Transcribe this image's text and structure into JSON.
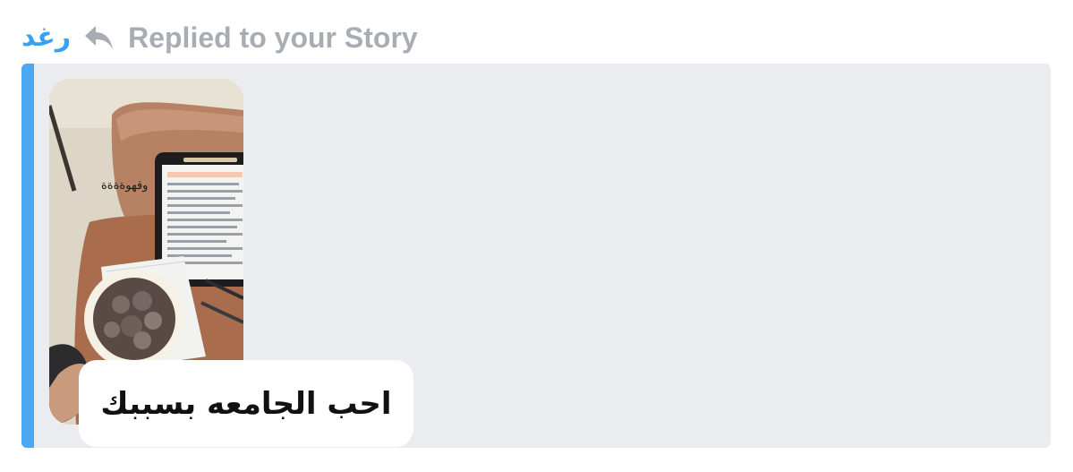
{
  "header": {
    "sender_name": "رغد",
    "reply_icon": "reply-arrow-icon",
    "status_text": "Replied to your Story"
  },
  "story": {
    "overlay_text": "وقهوةةةة",
    "image_description_icon": "story-thumbnail-image"
  },
  "message": {
    "text": "احب الجامعه بسببك"
  },
  "colors": {
    "accent_blue": "#3aa0f0",
    "quote_bar": "#4aa8f5",
    "quote_bg": "#ebecef",
    "muted_text": "#a8adb4"
  }
}
